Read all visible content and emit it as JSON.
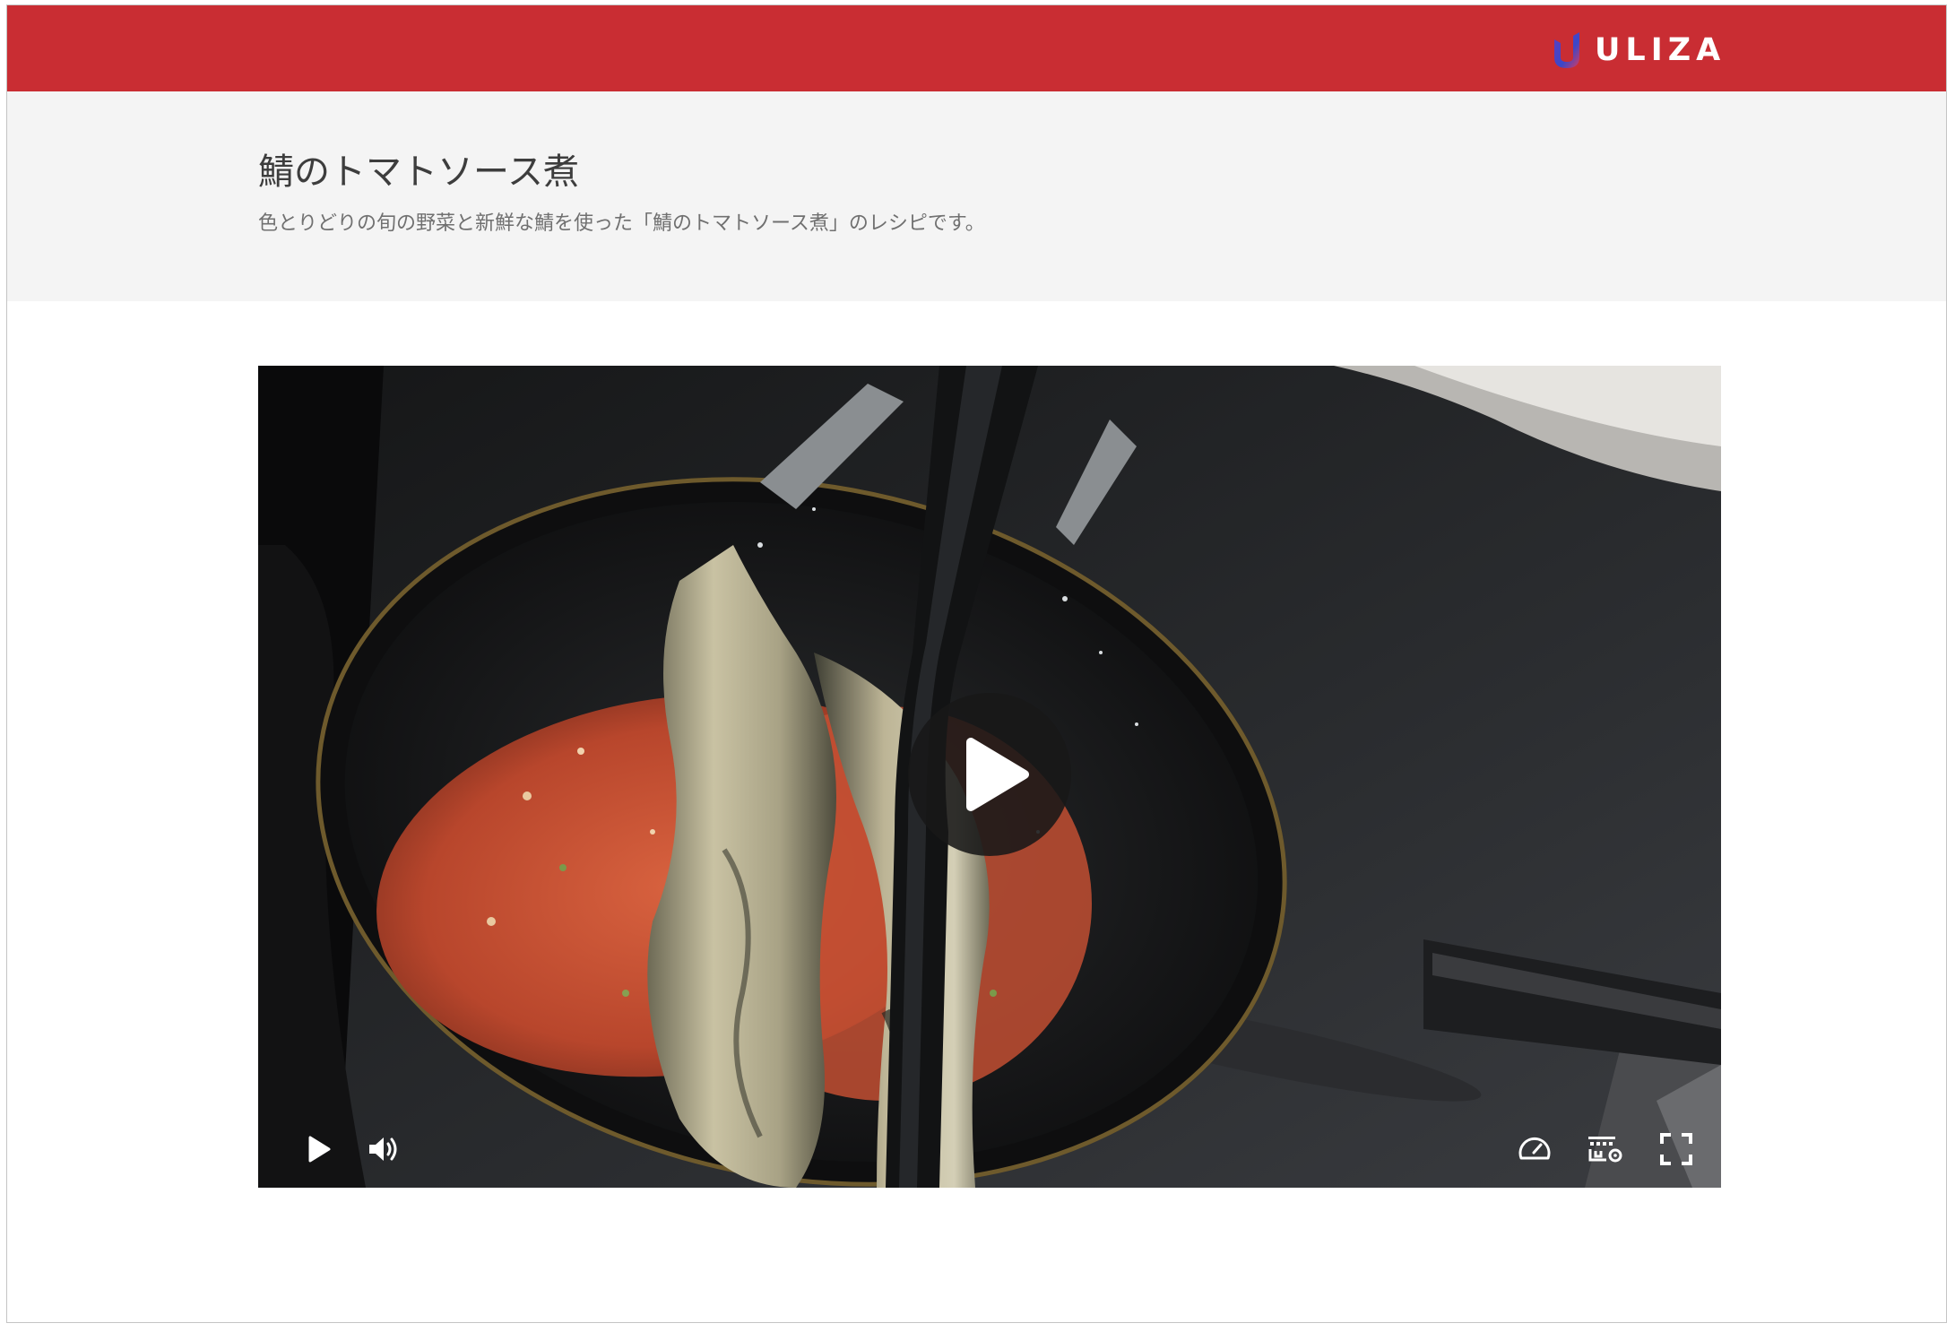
{
  "header": {
    "brand_logo_text": "ULIZA",
    "brand_color": "#c92d33"
  },
  "intro": {
    "title": "鯖のトマトソース煮",
    "description": "色とりどりの旬の野菜と新鮮な鯖を使った「鯖のトマトソース煮」のレシピです。"
  },
  "player": {
    "state": "paused",
    "center_button_icon": "play-icon",
    "controls_left": [
      "play-icon",
      "volume-icon"
    ],
    "controls_right": [
      "playback-speed-icon",
      "quality-settings-icon",
      "fullscreen-icon"
    ]
  }
}
